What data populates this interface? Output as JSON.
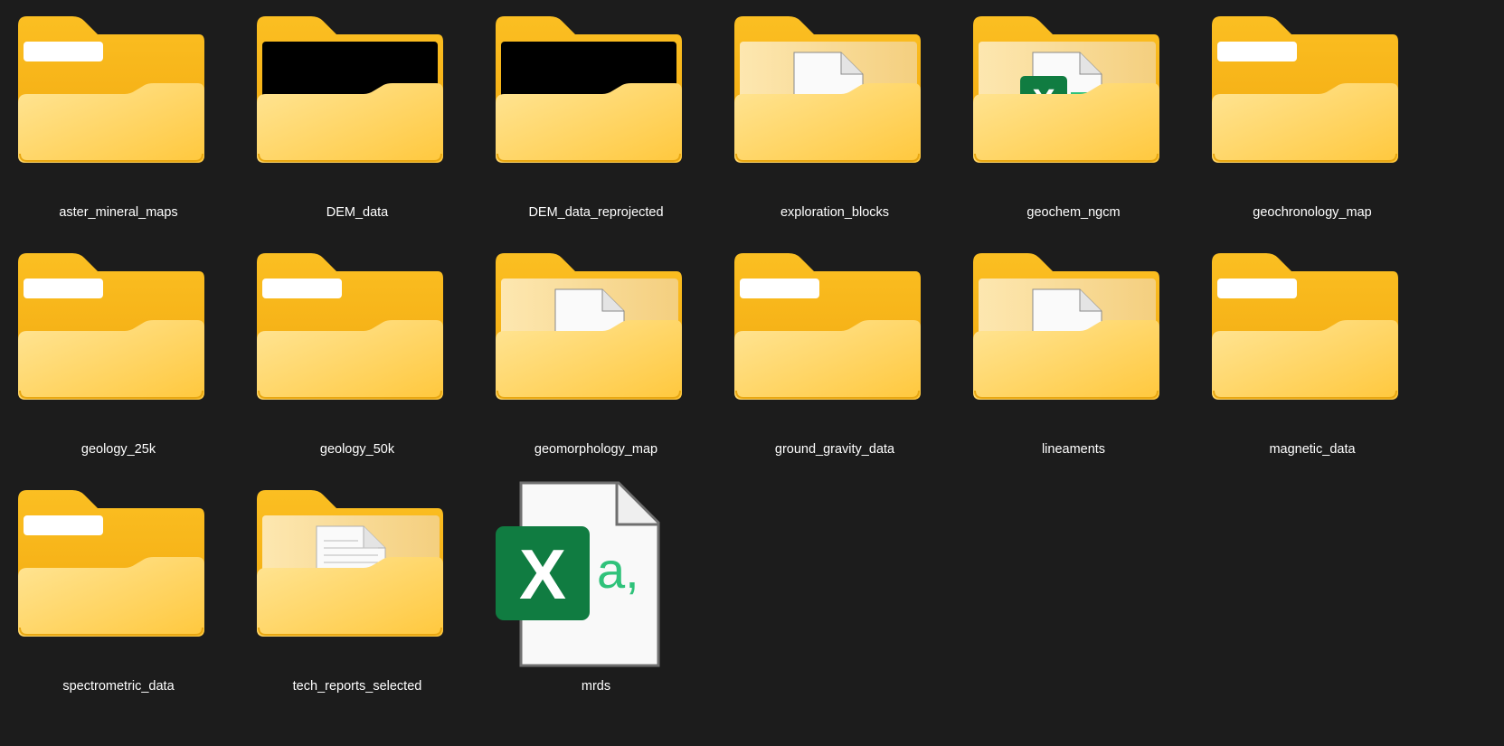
{
  "explorer": {
    "view": "large-icons",
    "items": [
      {
        "name": "aster_mineral_maps",
        "type": "folder",
        "preview": "empty"
      },
      {
        "name": "DEM_data",
        "type": "folder",
        "preview": "black-image"
      },
      {
        "name": "DEM_data_reprojected",
        "type": "folder",
        "preview": "black-image"
      },
      {
        "name": "exploration_blocks",
        "type": "folder",
        "preview": "document"
      },
      {
        "name": "geochem_ngcm",
        "type": "folder",
        "preview": "excel"
      },
      {
        "name": "geochronology_map",
        "type": "folder",
        "preview": "empty"
      },
      {
        "name": "geology_25k",
        "type": "folder",
        "preview": "empty"
      },
      {
        "name": "geology_50k",
        "type": "folder",
        "preview": "empty"
      },
      {
        "name": "geomorphology_map",
        "type": "folder",
        "preview": "document"
      },
      {
        "name": "ground_gravity_data",
        "type": "folder",
        "preview": "empty"
      },
      {
        "name": "lineaments",
        "type": "folder",
        "preview": "document"
      },
      {
        "name": "magnetic_data",
        "type": "folder",
        "preview": "empty"
      },
      {
        "name": "spectrometric_data",
        "type": "folder",
        "preview": "empty"
      },
      {
        "name": "tech_reports_selected",
        "type": "folder",
        "preview": "pdf"
      },
      {
        "name": "mrds",
        "type": "file",
        "preview": "excel-csv",
        "badge_text": "a,"
      }
    ]
  },
  "colors": {
    "background": "#1c1c1c",
    "folder_back": "#f7b91b",
    "folder_front": "#ffd65a",
    "excel_green": "#107c41",
    "csv_green": "#2fc27a"
  }
}
